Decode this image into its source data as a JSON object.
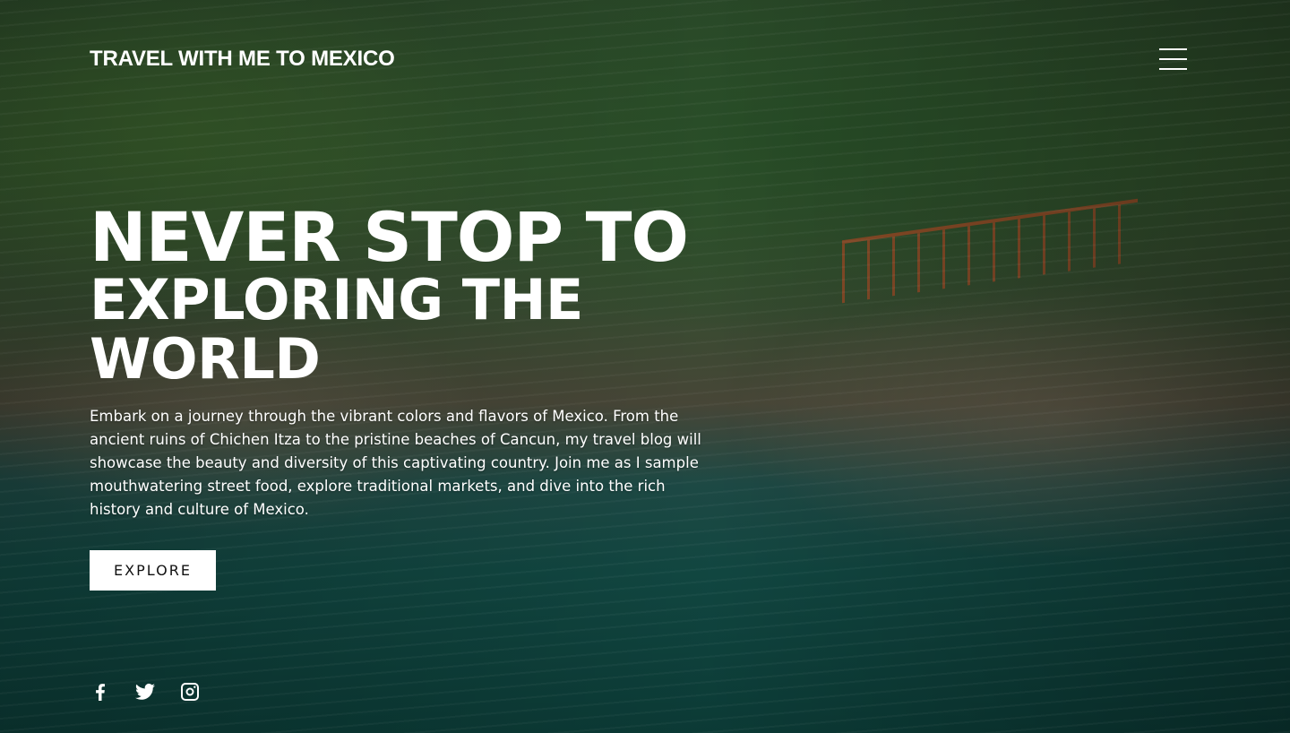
{
  "header": {
    "logo_text": "TRAVEL WITH ME TO MEXICO",
    "menu_icon": "hamburger-menu-icon"
  },
  "hero": {
    "title_line1": "NEVER STOP TO",
    "title_line2": "EXPLORING THE WORLD",
    "description": "Embark on a journey through the vibrant colors and flavors of Mexico. From the ancient ruins of Chichen Itza to the pristine beaches of Cancun, my travel blog will showcase the beauty and diversity of this captivating country. Join me as I sample mouthwatering street food, explore traditional markets, and dive into the rich history and culture of Mexico.",
    "button_label": "EXPLORE"
  },
  "social": {
    "icons": [
      "facebook-icon",
      "twitter-icon",
      "instagram-icon"
    ]
  },
  "colors": {
    "text": "#ffffff",
    "button_bg": "#ffffff",
    "button_text": "#111111"
  }
}
